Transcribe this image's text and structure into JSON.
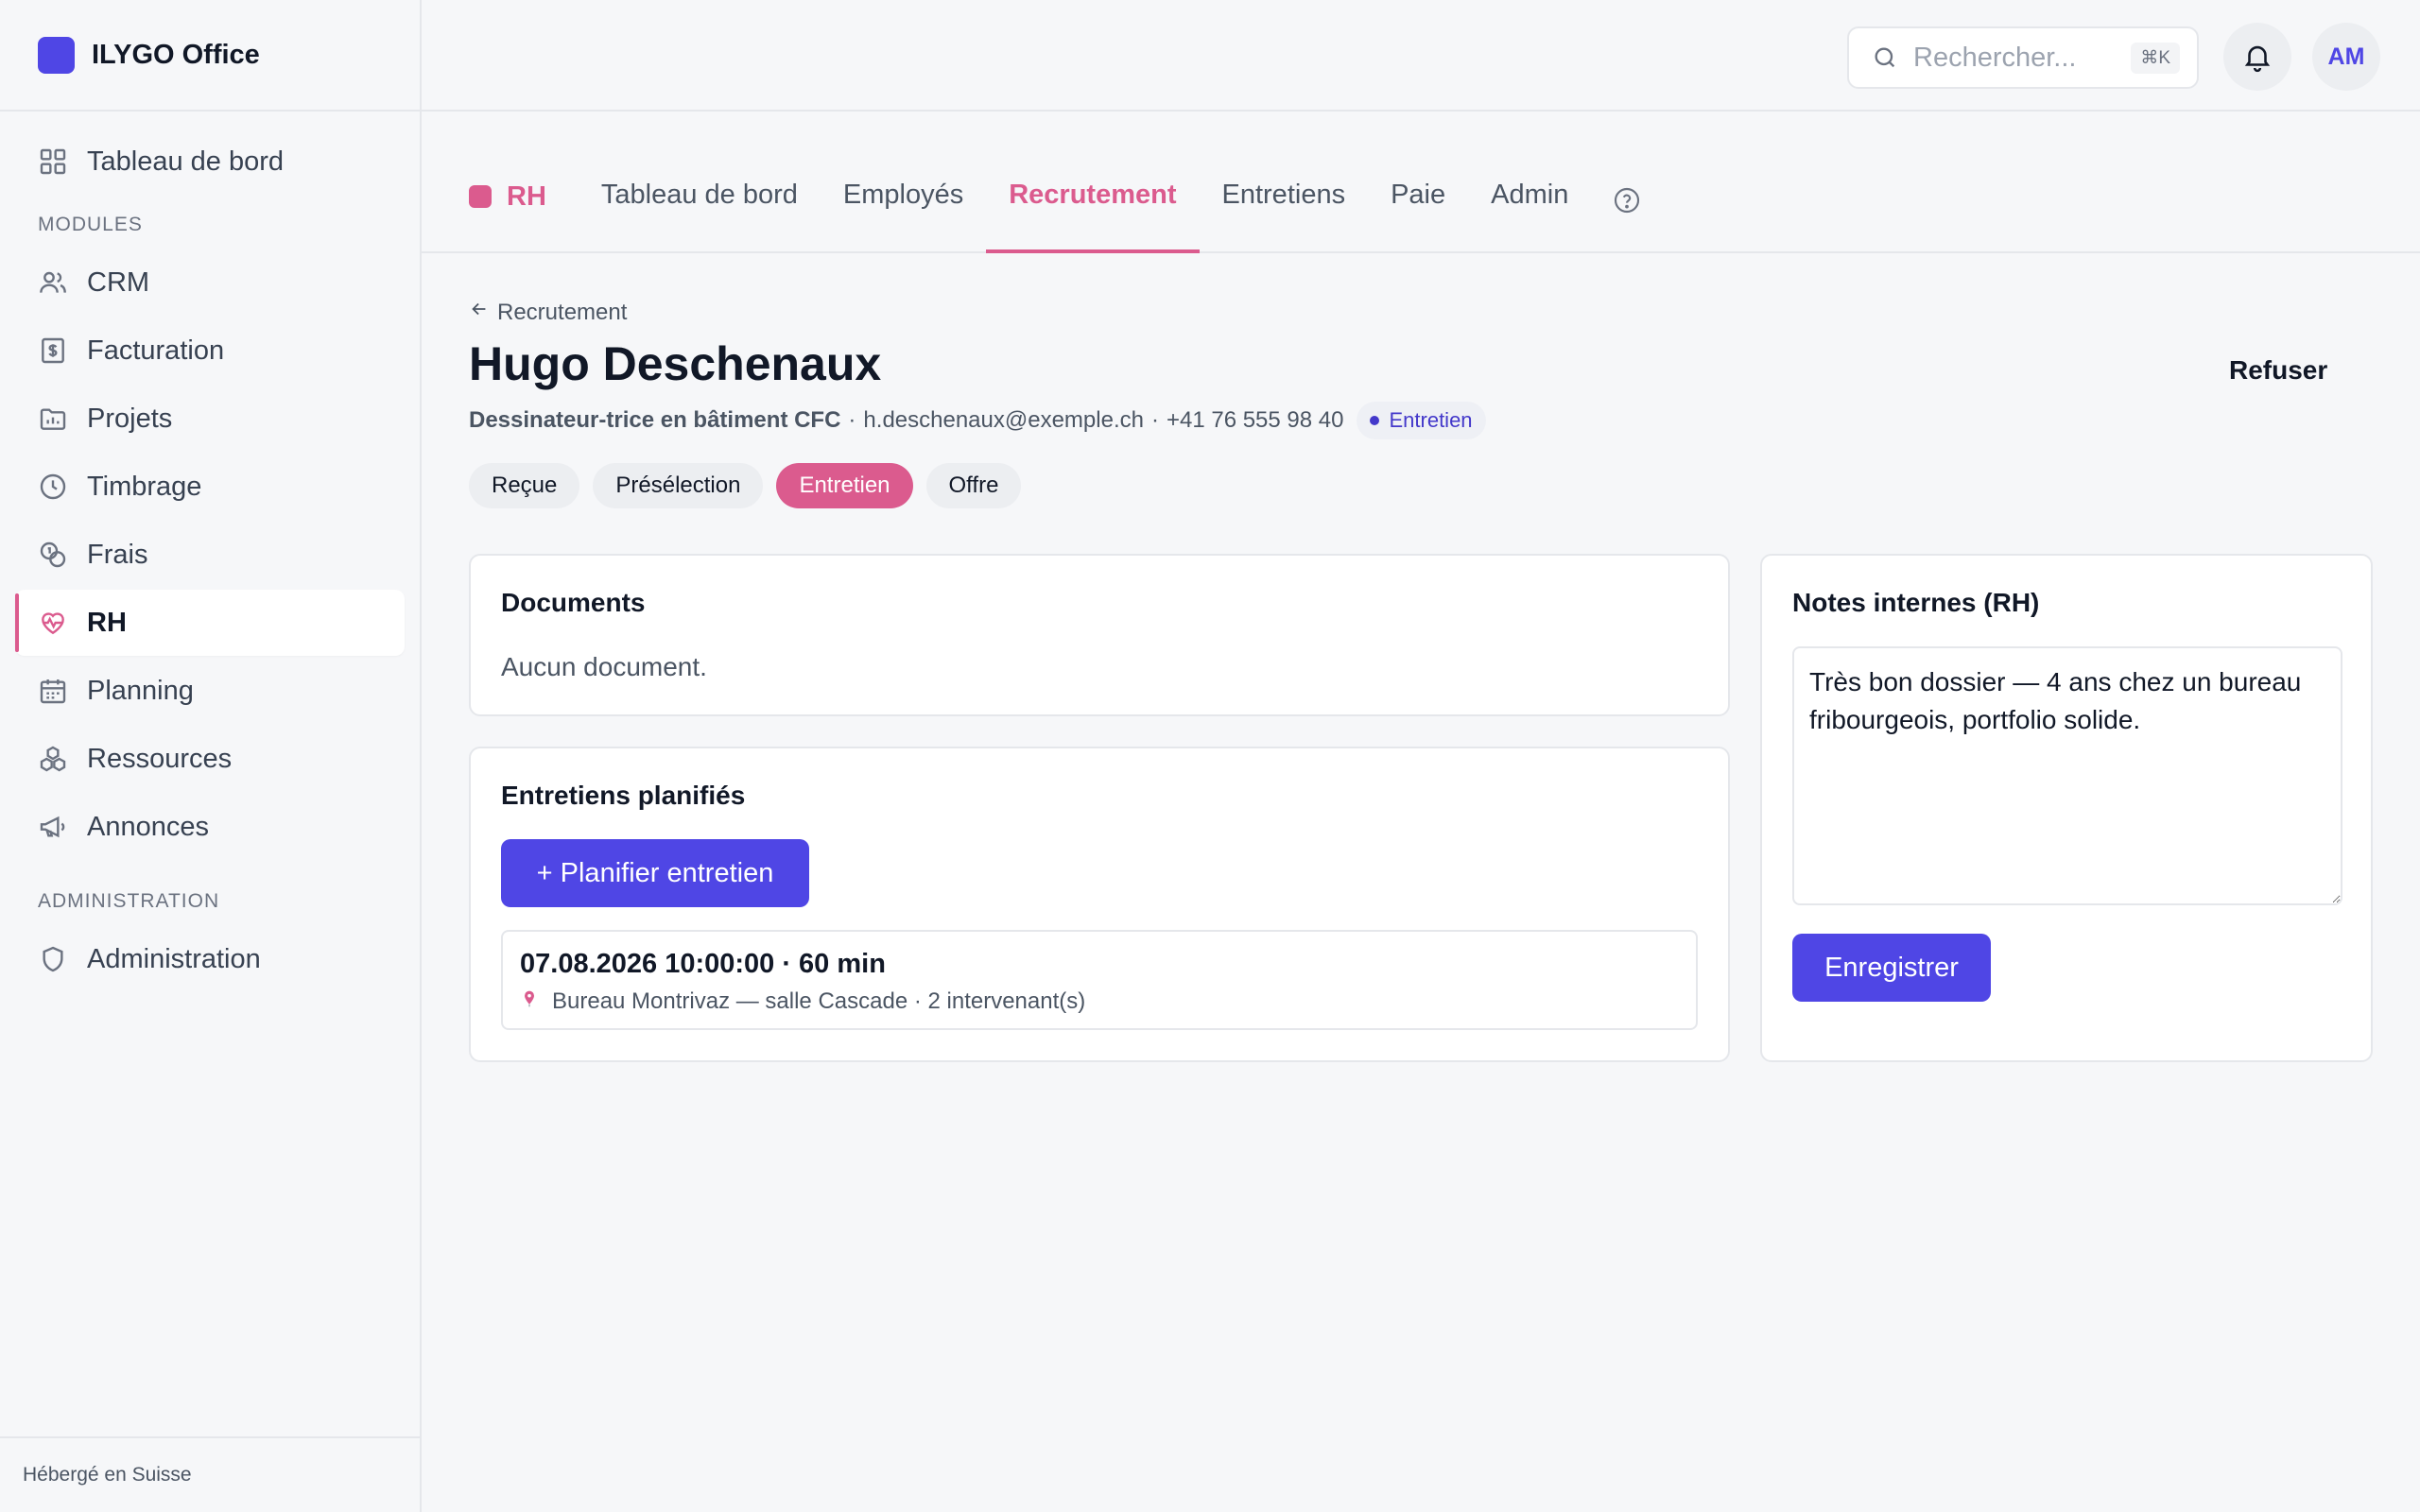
{
  "app": {
    "name": "ILYGO Office"
  },
  "sidebar": {
    "top_item": {
      "label": "Tableau de bord",
      "icon": "grid-icon"
    },
    "modules_label": "MODULES",
    "items": [
      {
        "label": "CRM",
        "icon": "users-icon"
      },
      {
        "label": "Facturation",
        "icon": "invoice-icon"
      },
      {
        "label": "Projets",
        "icon": "folder-chart-icon"
      },
      {
        "label": "Timbrage",
        "icon": "clock-icon"
      },
      {
        "label": "Frais",
        "icon": "coins-icon"
      },
      {
        "label": "RH",
        "icon": "heart-pulse-icon"
      },
      {
        "label": "Planning",
        "icon": "calendar-icon"
      },
      {
        "label": "Ressources",
        "icon": "boxes-icon"
      },
      {
        "label": "Annonces",
        "icon": "megaphone-icon"
      }
    ],
    "admin_label": "ADMINISTRATION",
    "admin_item": {
      "label": "Administration",
      "icon": "shield-icon"
    },
    "footer": "Hébergé en Suisse"
  },
  "topbar": {
    "search_placeholder": "Rechercher...",
    "search_shortcut": "⌘K",
    "avatar_initials": "AM"
  },
  "module": {
    "name": "RH",
    "tabs": [
      "Tableau de bord",
      "Employés",
      "Recrutement",
      "Entretiens",
      "Paie",
      "Admin"
    ],
    "active_tab": "Recrutement"
  },
  "candidate": {
    "back_label": "Recrutement",
    "name": "Hugo Deschenaux",
    "refuse_label": "Refuser",
    "role": "Dessinateur-trice en bâtiment CFC",
    "email": "h.deschenaux@exemple.ch",
    "phone": "+41 76 555 98 40",
    "status": "Entretien",
    "stages": [
      "Reçue",
      "Présélection",
      "Entretien",
      "Offre"
    ],
    "active_stage": "Entretien"
  },
  "documents": {
    "title": "Documents",
    "empty": "Aucun document."
  },
  "interviews": {
    "title": "Entretiens planifiés",
    "plan_button": "+ Planifier entretien",
    "slots": [
      {
        "when": "07.08.2026 10:00:00 · 60 min",
        "where": "Bureau Montrivaz — salle Cascade · 2 intervenant(s)"
      }
    ]
  },
  "notes": {
    "title": "Notes internes (RH)",
    "value": "Très bon dossier — 4 ans chez un bureau fribourgeois, portfolio solide.",
    "save_button": "Enregistrer"
  },
  "colors": {
    "accent": "#4f46e5",
    "module": "#db5b8e",
    "background": "#f6f7f9"
  }
}
